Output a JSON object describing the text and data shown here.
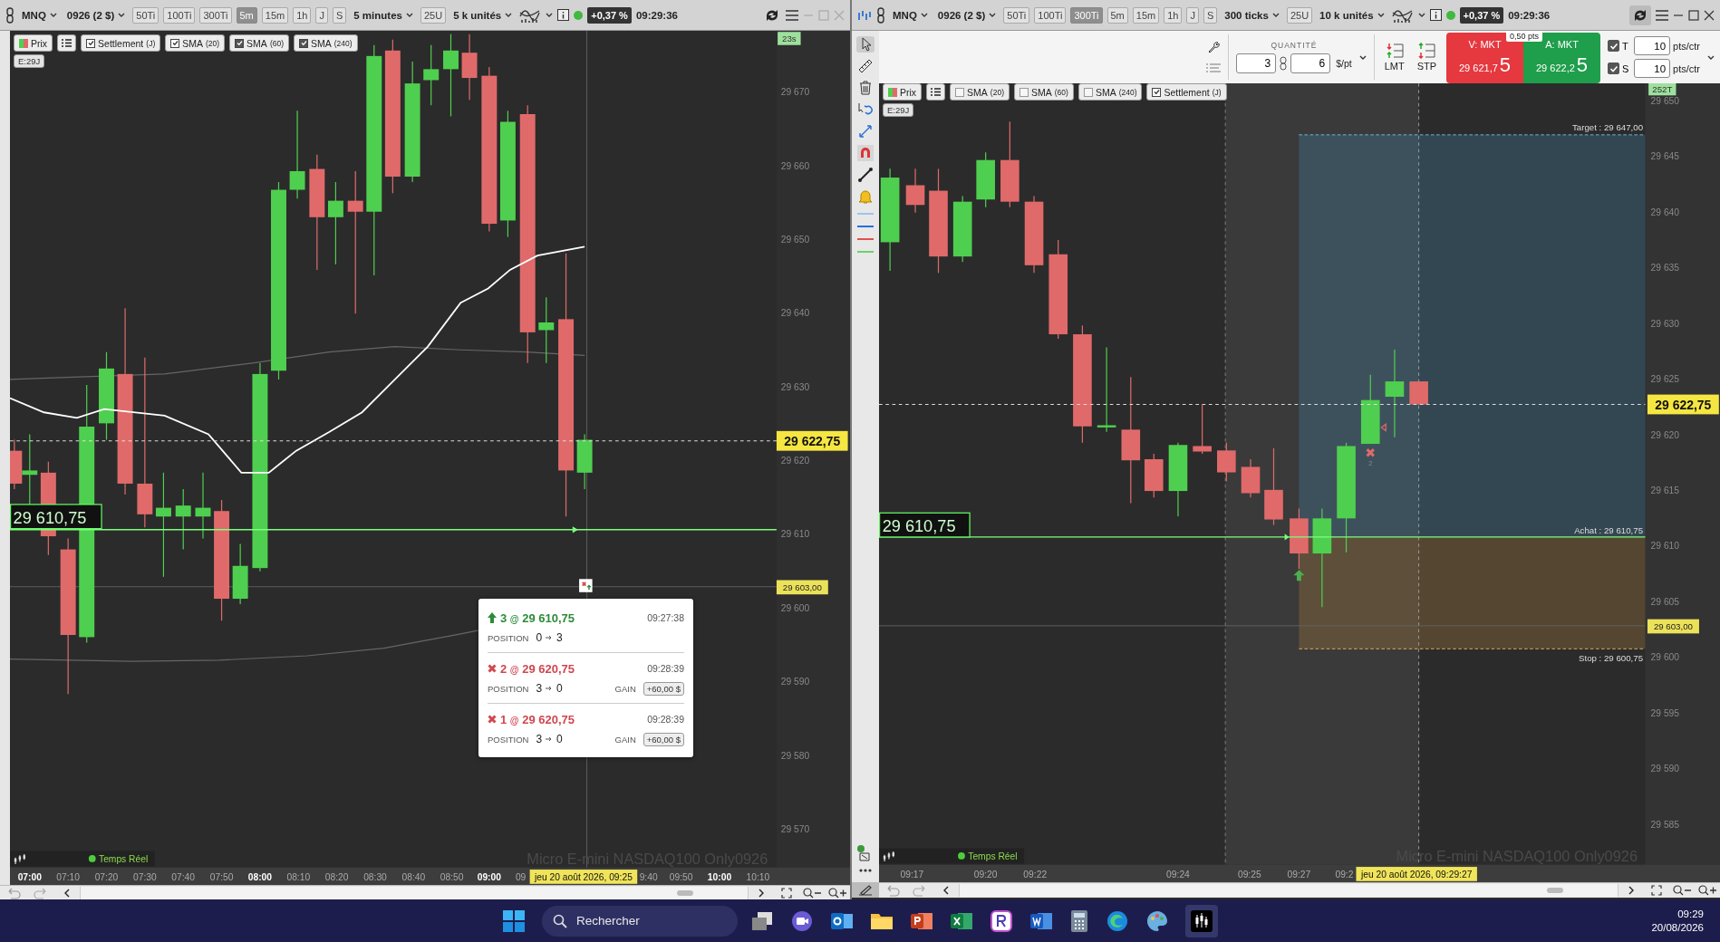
{
  "left_window": {
    "toolbar": {
      "symbol": "MNQ",
      "contract": "0926 (2 $)",
      "intervals": [
        {
          "label": "50Ti",
          "selected": false
        },
        {
          "label": "100Ti",
          "selected": false
        },
        {
          "label": "300Ti",
          "selected": false
        },
        {
          "label": "5m",
          "selected": true
        },
        {
          "label": "15m",
          "selected": false
        },
        {
          "label": "1h",
          "selected": false
        },
        {
          "label": "J",
          "selected": false
        },
        {
          "label": "S",
          "selected": false
        }
      ],
      "period": "5 minutes",
      "units_button": "25U",
      "volume": "5 k unités",
      "change": "+0,37 %",
      "time": "09:29:36"
    },
    "legend": {
      "price_button": "Prix",
      "indicators": [
        {
          "label": "Settlement",
          "param": "(J)",
          "visible": true,
          "color": "#ffffff"
        },
        {
          "label": "SMA",
          "param": "(20)",
          "visible": true,
          "color": "#ffffff"
        },
        {
          "label": "SMA",
          "param": "(60)",
          "visible": true,
          "color": "#555555"
        },
        {
          "label": "SMA",
          "param": "(240)",
          "visible": true,
          "color": "#555555"
        }
      ],
      "expiry": "E:29J"
    },
    "chart": {
      "timer_badge": "23s",
      "price_axis": [
        "29 670",
        "29 660",
        "29 650",
        "29 640",
        "29 630",
        "29 620",
        "29 610",
        "29 600",
        "29 590",
        "29 580",
        "29 570"
      ],
      "current_price": "29 622,75",
      "entry_price_badge": "29 610,75",
      "stop_price_badge": "29 603,00",
      "status": "Temps Réel",
      "instrument": "Micro E-mini NASDAQ100 Only0926",
      "time_axis": [
        {
          "label": "07:00",
          "major": true
        },
        {
          "label": "07:10",
          "major": false
        },
        {
          "label": "07:20",
          "major": false
        },
        {
          "label": "07:30",
          "major": false
        },
        {
          "label": "07:40",
          "major": false
        },
        {
          "label": "07:50",
          "major": false
        },
        {
          "label": "08:00",
          "major": true
        },
        {
          "label": "08:10",
          "major": false
        },
        {
          "label": "08:20",
          "major": false
        },
        {
          "label": "08:30",
          "major": false
        },
        {
          "label": "08:40",
          "major": false
        },
        {
          "label": "08:50",
          "major": false
        },
        {
          "label": "09:00",
          "major": true
        },
        {
          "label": "09",
          "major": false
        },
        {
          "label": "9:40",
          "major": false
        },
        {
          "label": "09:50",
          "major": false
        },
        {
          "label": "10:00",
          "major": true
        },
        {
          "label": "10:10",
          "major": false
        }
      ],
      "date_badge": "jeu 20 août 2026, 09:25"
    },
    "trade_popup": [
      {
        "kind": "buy",
        "qty": "3",
        "at": "@",
        "price": "29 610,75",
        "time": "09:27:38",
        "position_label": "POSITION",
        "from": "0",
        "to": "3"
      },
      {
        "kind": "exit",
        "qty": "2",
        "at": "@",
        "price": "29 620,75",
        "time": "09:28:39",
        "position_label": "POSITION",
        "from": "3",
        "to": "0",
        "gain_label": "GAIN",
        "gain": "+60,00 $"
      },
      {
        "kind": "exit",
        "qty": "1",
        "at": "@",
        "price": "29 620,75",
        "time": "09:28:39",
        "position_label": "POSITION",
        "from": "3",
        "to": "0",
        "gain_label": "GAIN",
        "gain": "+60,00 $"
      }
    ]
  },
  "right_window": {
    "toolbar": {
      "symbol": "MNQ",
      "contract": "0926 (2 $)",
      "intervals": [
        {
          "label": "50Ti",
          "selected": false
        },
        {
          "label": "100Ti",
          "selected": false
        },
        {
          "label": "300Ti",
          "selected": true
        },
        {
          "label": "5m",
          "selected": false
        },
        {
          "label": "15m",
          "selected": false
        },
        {
          "label": "1h",
          "selected": false
        },
        {
          "label": "J",
          "selected": false
        },
        {
          "label": "S",
          "selected": false
        }
      ],
      "period": "300 ticks",
      "units_button": "25U",
      "volume": "10 k unités",
      "change": "+0,37 %",
      "time": "09:29:36"
    },
    "order_panel": {
      "quantity_label": "QUANTITÉ",
      "quantity": "3",
      "multiplier": "6",
      "unit": "$/pt",
      "limit_button": "LMT",
      "stop_button": "STP",
      "sell": {
        "label": "V: MKT",
        "price": "29 621,7",
        "price_last": "5"
      },
      "spread": "0,50 pts",
      "buy": {
        "label": "A: MKT",
        "price": "29 622,2",
        "price_last": "5"
      },
      "brackets": [
        {
          "label": "T",
          "checked": true,
          "value": "10",
          "unit": "pts/ctr"
        },
        {
          "label": "S",
          "checked": true,
          "value": "10",
          "unit": "pts/ctr"
        }
      ]
    },
    "legend": {
      "price_button": "Prix",
      "indicators": [
        {
          "label": "SMA",
          "param": "(20)",
          "visible": false
        },
        {
          "label": "SMA",
          "param": "(60)",
          "visible": false
        },
        {
          "label": "SMA",
          "param": "(240)",
          "visible": false
        },
        {
          "label": "Settlement",
          "param": "(J)",
          "visible": true,
          "color": "#ffffff"
        }
      ],
      "expiry": "E:29J"
    },
    "chart": {
      "timer_badge": "252T",
      "price_axis": [
        "29 650",
        "29 645",
        "29 640",
        "29 635",
        "29 630",
        "29 625",
        "29 620",
        "29 615",
        "29 610",
        "29 605",
        "29 600",
        "29 595",
        "29 590",
        "29 585"
      ],
      "current_price": "29 622,75",
      "entry_price_badge": "29 610,75",
      "stop_price_badge": "29 603,00",
      "target_label": "Target : 29 647,00",
      "entry_label": "Achat : 29 610,75",
      "stop_label": "Stop : 29 600,75",
      "exit_marker_label": "2",
      "status": "Temps Réel",
      "instrument": "Micro E-mini NASDAQ100 Only0926",
      "time_axis": [
        {
          "label": "09:17",
          "major": false
        },
        {
          "label": "09:20",
          "major": false
        },
        {
          "label": "09:22",
          "major": false
        },
        {
          "label": "09:24",
          "major": false
        },
        {
          "label": "09:25",
          "major": false
        },
        {
          "label": "09:27",
          "major": false
        },
        {
          "label": "09:2",
          "major": false
        }
      ],
      "date_badge": "jeu 20 août 2026, 09:29:27"
    }
  },
  "taskbar": {
    "search_placeholder": "Rechercher",
    "clock_time": "09:29",
    "clock_date": "20/08/2026"
  }
}
